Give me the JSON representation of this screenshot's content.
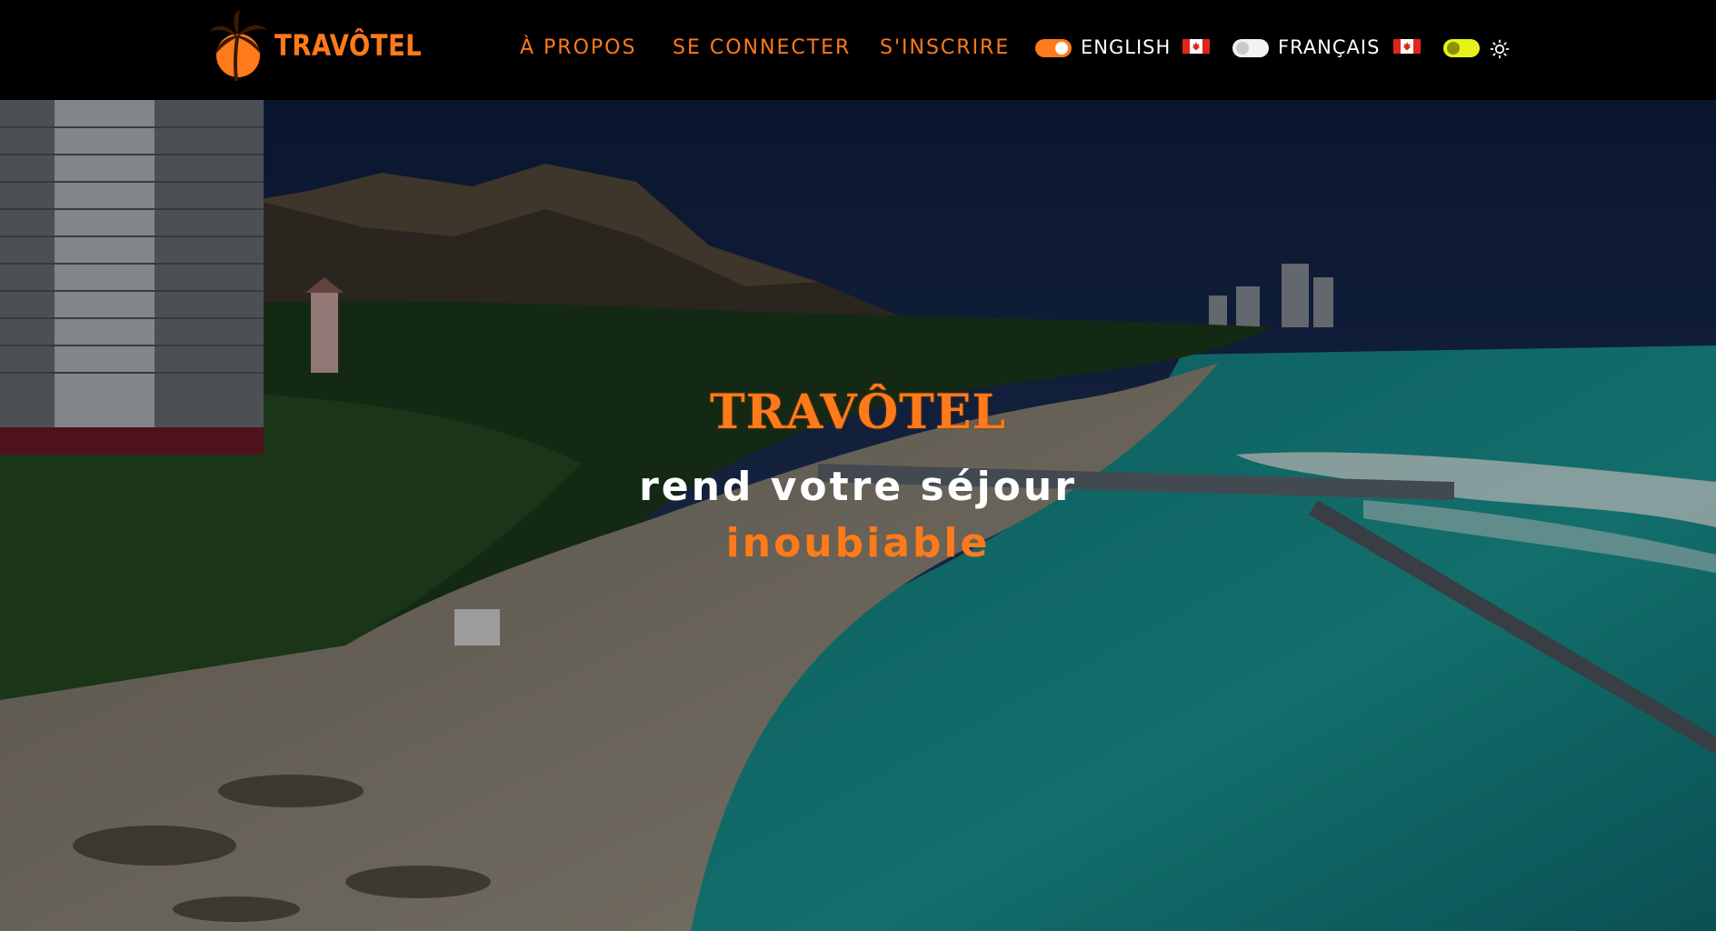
{
  "brand": {
    "logo_text": "TRAVÔTEL",
    "logo_icon": "palm-tree-sun-icon",
    "accent_color": "#ff7a1a"
  },
  "nav": {
    "about": "À PROPOS",
    "login": "SE CONNECTER",
    "signup": "S'INSCRIRE"
  },
  "language": {
    "english_label": "ENGLISH",
    "english_enabled": true,
    "english_flag": "canada-flag-icon",
    "french_label": "FRANÇAIS",
    "french_enabled": false,
    "french_flag": "canada-flag-icon"
  },
  "theme": {
    "toggle_color": "#e6f21b",
    "icon": "sun-icon"
  },
  "hero": {
    "brand": "TRAVÔTEL",
    "line1": "rend votre séjour",
    "line2": "inoubiable"
  }
}
